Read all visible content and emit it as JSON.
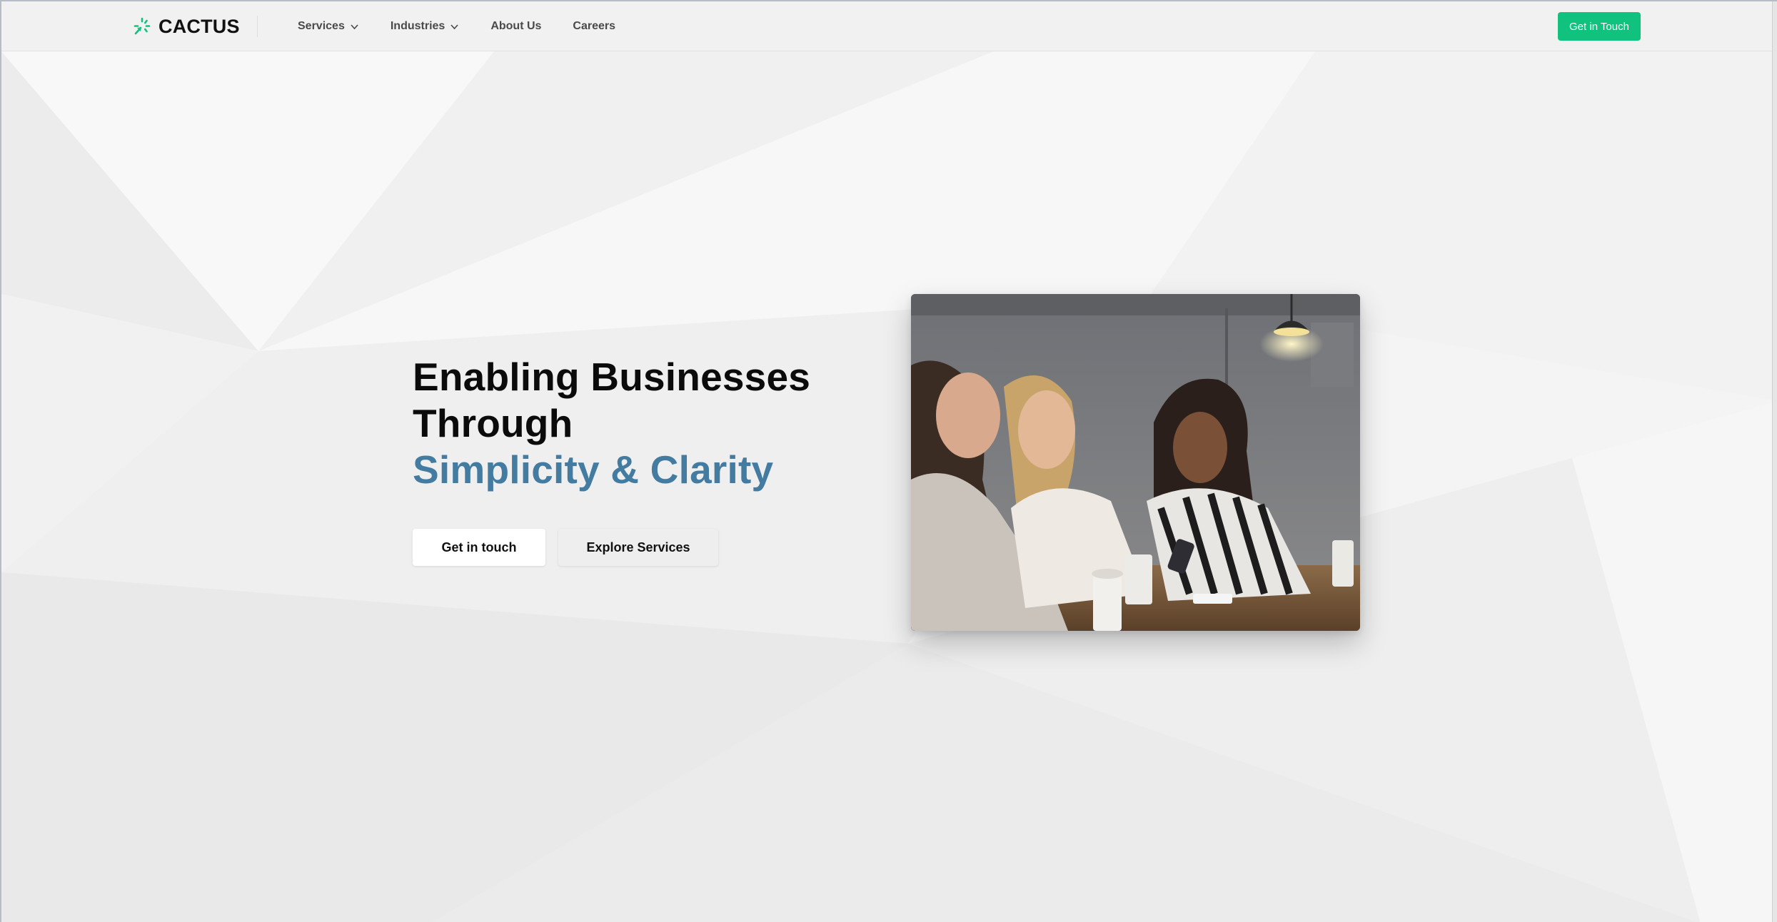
{
  "brand": {
    "name": "CACTUS",
    "icon": "cactus-spark-logo-icon",
    "accent_color": "#10c27e"
  },
  "nav": {
    "items": [
      {
        "label": "Services",
        "dropdown": true
      },
      {
        "label": "Industries",
        "dropdown": true
      },
      {
        "label": "About Us",
        "dropdown": false
      },
      {
        "label": "Careers",
        "dropdown": false
      }
    ],
    "cta_label": "Get in Touch"
  },
  "hero": {
    "title_line1": "Enabling Businesses",
    "title_line2": "Through",
    "title_accent": "Simplicity & Clarity",
    "accent_color": "#437ba1",
    "primary_button": "Get in touch",
    "secondary_button": "Explore Services",
    "image_subject": "three women looking at a smartphone in a cafe"
  }
}
